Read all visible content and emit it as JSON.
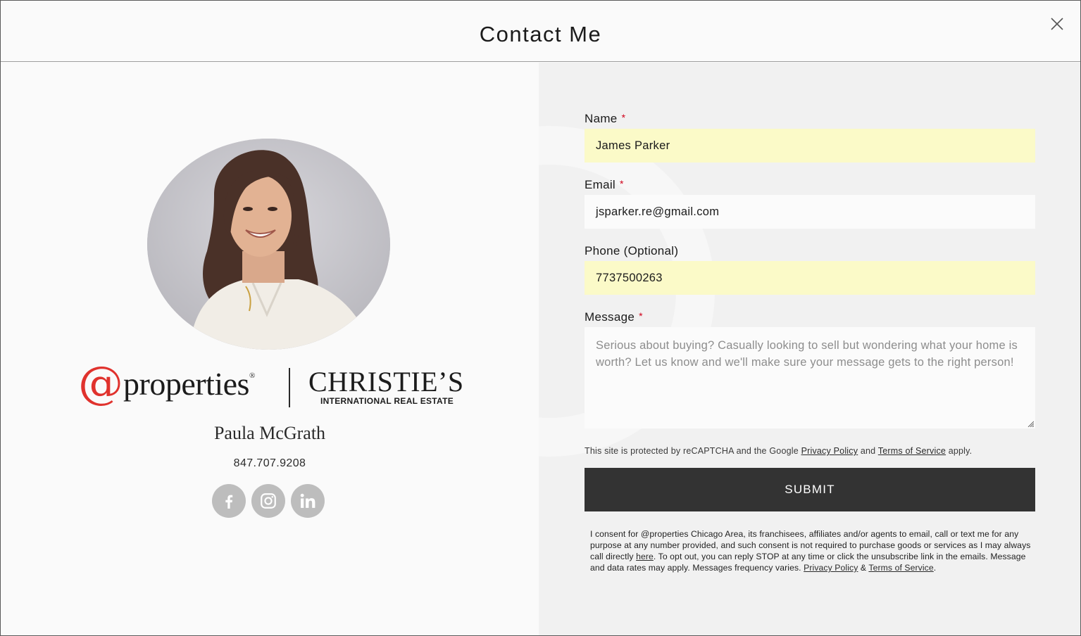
{
  "header": {
    "title": "Contact Me"
  },
  "agent": {
    "name": "Paula McGrath",
    "phone": "847.707.9208",
    "photo_alt": "agent-photo"
  },
  "brand": {
    "at_symbol": "@",
    "properties": "properties",
    "registered": "®",
    "christies": "CHRISTIE’S",
    "christies_sub": "INTERNATIONAL REAL ESTATE",
    "at_color": "#e0322d"
  },
  "social": [
    {
      "name": "facebook",
      "icon": "facebook-icon"
    },
    {
      "name": "instagram",
      "icon": "instagram-icon"
    },
    {
      "name": "linkedin",
      "icon": "linkedin-icon"
    }
  ],
  "form": {
    "name": {
      "label": "Name",
      "required_mark": "*",
      "value": "James Parker"
    },
    "email": {
      "label": "Email",
      "required_mark": "*",
      "value": "jsparker.re@gmail.com"
    },
    "phone": {
      "label": "Phone (Optional)",
      "value": "7737500263"
    },
    "message": {
      "label": "Message",
      "required_mark": "*",
      "placeholder": "Serious about buying? Casually looking to sell but wondering what your home is worth? Let us know and we'll make sure your message gets to the right person!"
    },
    "recaptcha": {
      "prefix": "This site is protected by reCAPTCHA and the Google ",
      "privacy_link": "Privacy Policy",
      "and": " and ",
      "terms_link": "Terms of Service",
      "suffix": " apply."
    },
    "submit_label": "SUBMIT",
    "consent": {
      "part1": "I consent for @properties Chicago Area, its franchisees, affiliates and/or agents to email, call or text me for any purpose at any number provided, and such consent is not required to purchase goods or services as I may always call directly ",
      "here_link": "here",
      "part2": ". To opt out, you can reply STOP at any time or click the unsubscribe link in the emails. Message and data rates may apply. Messages frequency varies. ",
      "privacy_link": "Privacy Policy",
      "amp": " & ",
      "terms_link": "Terms of Service",
      "end": "."
    }
  },
  "colors": {
    "autofill": "#fbfac8",
    "submit_bg": "#333333",
    "required": "#d0021b",
    "right_panel_bg": "#f1f1f1"
  }
}
